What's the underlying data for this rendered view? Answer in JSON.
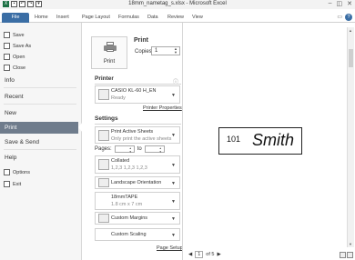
{
  "window": {
    "title": "18mm_nametag_s.xlsx - Microsoft Excel",
    "minimize_glyph": "▭",
    "help_glyph": "?"
  },
  "ribbon": {
    "tabs": [
      "File",
      "Home",
      "Insert",
      "Page Layout",
      "Formulas",
      "Data",
      "Review",
      "View"
    ]
  },
  "nav": {
    "save": "Save",
    "save_as": "Save As",
    "open": "Open",
    "close": "Close",
    "info": "Info",
    "recent": "Recent",
    "new": "New",
    "print": "Print",
    "save_send": "Save & Send",
    "help": "Help",
    "options": "Options",
    "exit": "Exit"
  },
  "print": {
    "heading": "Print",
    "button_label": "Print",
    "copies_label": "Copies:",
    "copies_value": "1"
  },
  "printer": {
    "heading": "Printer",
    "name": "CASIO KL-60 H_EN",
    "status": "Ready",
    "properties_link": "Printer Properties"
  },
  "settings": {
    "heading": "Settings",
    "what_to_print": "Print Active Sheets",
    "what_to_print_sub": "Only print the active sheets",
    "pages_label": "Pages:",
    "to_label": "to",
    "collation": "Collated",
    "collation_sub": "1,2,3   1,2,3   1,2,3",
    "orientation": "Landscape Orientation",
    "paper": "18mmTAPE",
    "paper_sub": "1.8 cm x 7 cm",
    "margins": "Custom Margins",
    "scaling": "Custom Scaling",
    "page_setup_link": "Page Setup"
  },
  "preview": {
    "label_number": "101",
    "label_name": "Smith",
    "page_current": "1",
    "page_total_text": "of 5"
  }
}
